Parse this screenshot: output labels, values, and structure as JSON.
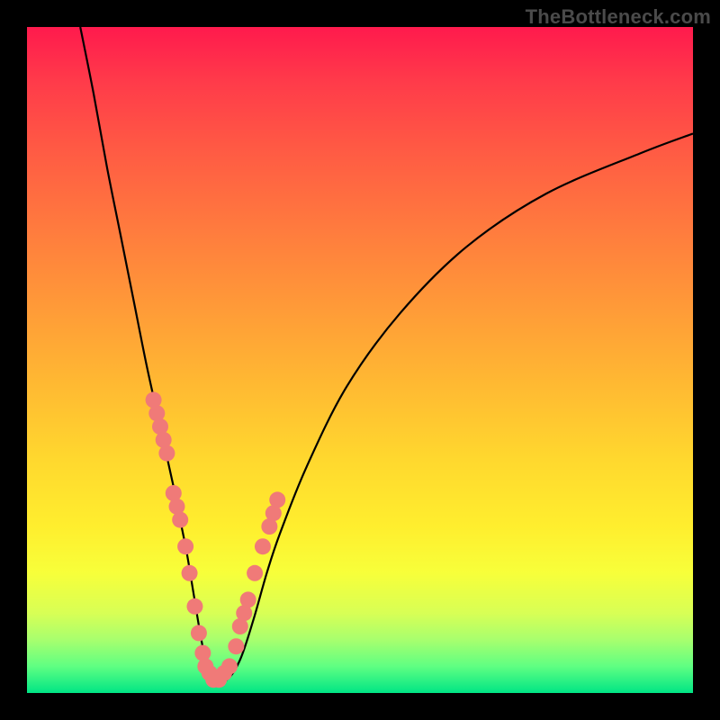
{
  "watermark": "TheBottleneck.com",
  "chart_data": {
    "type": "line",
    "title": "",
    "xlabel": "",
    "ylabel": "",
    "xlim": [
      0,
      100
    ],
    "ylim": [
      0,
      100
    ],
    "series": [
      {
        "name": "bottleneck-curve",
        "x": [
          8,
          10,
          12,
          14,
          16,
          18,
          20,
          22,
          23,
          24,
          25,
          26,
          27,
          28,
          30,
          32,
          34,
          36,
          38,
          42,
          48,
          56,
          66,
          78,
          92,
          100
        ],
        "y": [
          100,
          90,
          79,
          69,
          59,
          49,
          40,
          31,
          26,
          21,
          15,
          9,
          4,
          2,
          2,
          5,
          11,
          18,
          24,
          34,
          46,
          57,
          67,
          75,
          81,
          84
        ]
      }
    ],
    "markers": {
      "name": "highlight-dots",
      "color": "#f07a78",
      "x": [
        19.0,
        19.5,
        20.0,
        20.5,
        21.0,
        22.0,
        22.5,
        23.0,
        23.8,
        24.4,
        25.2,
        25.8,
        26.4,
        26.8,
        27.4,
        28.0,
        28.8,
        29.6,
        30.4,
        31.4,
        32.0,
        32.6,
        33.2,
        34.2,
        35.4,
        36.4,
        37.0,
        37.6
      ],
      "y": [
        44.0,
        42.0,
        40.0,
        38.0,
        36.0,
        30.0,
        28.0,
        26.0,
        22.0,
        18.0,
        13.0,
        9.0,
        6.0,
        4.0,
        3.0,
        2.0,
        2.0,
        3.0,
        4.0,
        7.0,
        10.0,
        12.0,
        14.0,
        18.0,
        22.0,
        25.0,
        27.0,
        29.0
      ]
    },
    "gradient_stops": [
      {
        "pos": 0,
        "color": "#ff1a4d"
      },
      {
        "pos": 30,
        "color": "#ff7a3e"
      },
      {
        "pos": 65,
        "color": "#ffd82e"
      },
      {
        "pos": 82,
        "color": "#f7ff3a"
      },
      {
        "pos": 100,
        "color": "#00e585"
      }
    ]
  }
}
